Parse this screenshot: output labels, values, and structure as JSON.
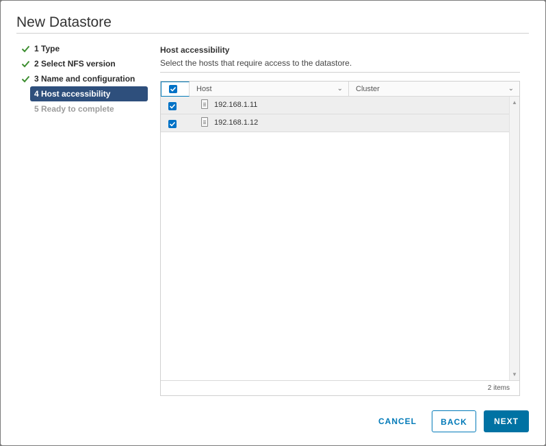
{
  "dialog": {
    "title": "New Datastore"
  },
  "steps": [
    {
      "label": "1 Type",
      "state": "done"
    },
    {
      "label": "2 Select NFS version",
      "state": "done"
    },
    {
      "label": "3 Name and configuration",
      "state": "done"
    },
    {
      "label": "4 Host accessibility",
      "state": "active"
    },
    {
      "label": "5 Ready to complete",
      "state": "disabled"
    }
  ],
  "section": {
    "title": "Host accessibility",
    "subtitle": "Select the hosts that require access to the datastore."
  },
  "grid": {
    "columns": [
      {
        "label": "Host"
      },
      {
        "label": "Cluster"
      }
    ],
    "rows": [
      {
        "host": "192.168.1.11",
        "cluster": "",
        "checked": true
      },
      {
        "host": "192.168.1.12",
        "cluster": "",
        "checked": true
      }
    ],
    "footer": "2 items"
  },
  "buttons": {
    "cancel": "CANCEL",
    "back": "BACK",
    "next": "NEXT"
  },
  "colors": {
    "accent": "#0079b8",
    "active_step": "#2e4f7c",
    "check_green": "#3c8d2f"
  }
}
